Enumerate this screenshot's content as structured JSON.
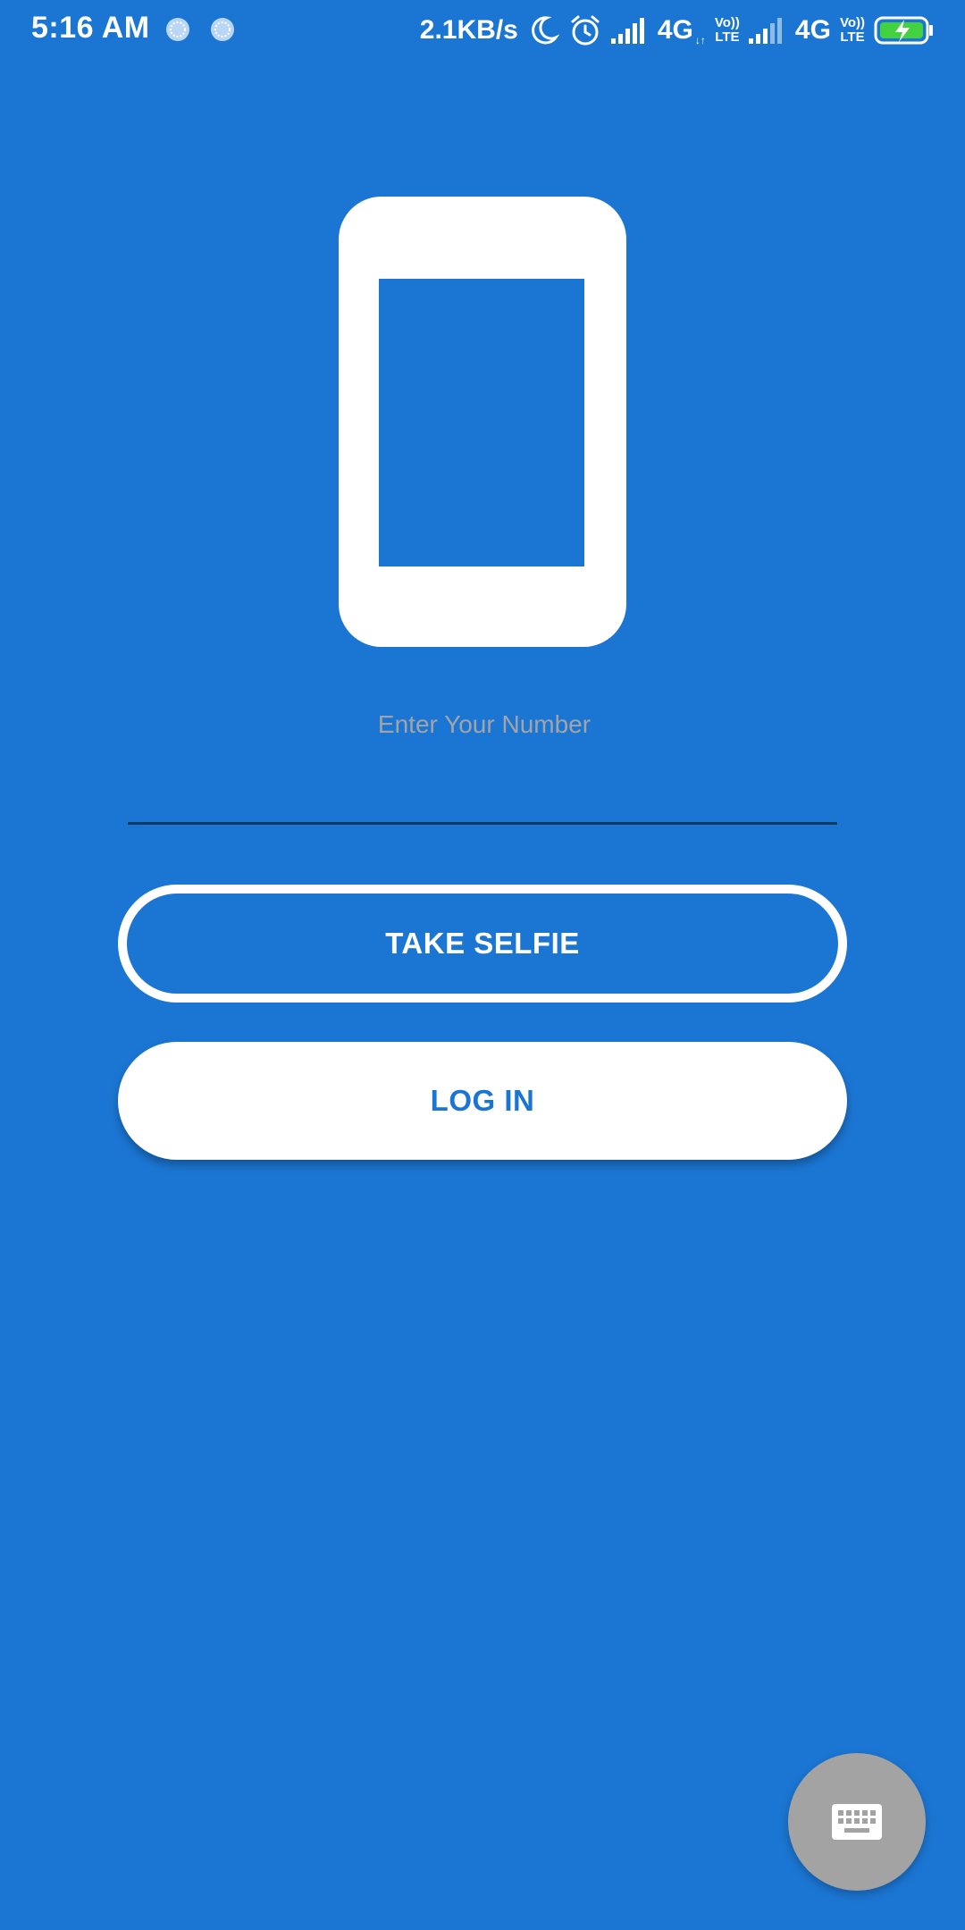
{
  "status_bar": {
    "time": "5:16 AM",
    "net_speed": "2.1KB/s",
    "sim1_type": "4G",
    "sim2_type": "4G",
    "volte_top": "Vo))",
    "volte_bottom": "LTE",
    "data_arrows": "↓↑",
    "battery_color": "#43d13f"
  },
  "login": {
    "number_placeholder": "Enter Your Number",
    "number_value": "",
    "take_selfie_label": "TAKE SELFIE",
    "login_label": "LOG IN"
  },
  "colors": {
    "background": "#1b76d3",
    "primary_text_on_white": "#1b76d3",
    "placeholder": "#a2a4a8",
    "fab": "#a3a3a3"
  }
}
